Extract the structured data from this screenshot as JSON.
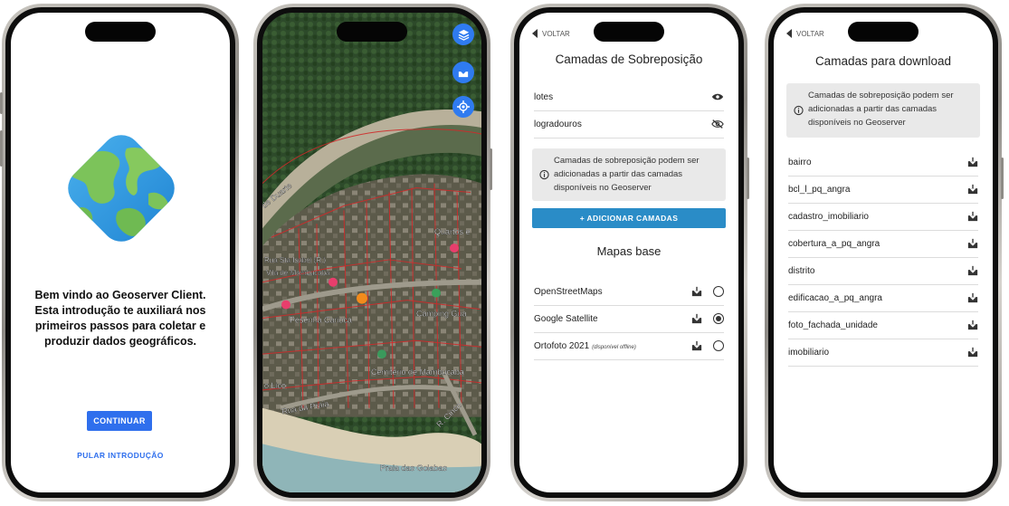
{
  "screen1": {
    "welcome_text": "Bem vindo ao Geoserver Client. Esta introdução te auxiliará nos primeiros passos para coletar e produzir dados geográficos.",
    "continue_label": "CONTINUAR",
    "skip_label": "PULAR INTRODUÇÃO",
    "accent": "#2f6fed"
  },
  "screen2": {
    "buttons": [
      {
        "icon": "layers-icon"
      },
      {
        "icon": "download-icon"
      },
      {
        "icon": "locate-icon"
      }
    ],
    "map_labels": [
      "de Duarte",
      "Quartos e",
      "Rua Sta Isabel (R.)",
      "Vila de Mambucaba",
      "Pesenha Carioca",
      "Camping Gua",
      "o Lico",
      "Cemitério de Mambucaba",
      "Rua da Praia",
      "R. Cinco",
      "Praia das Goiabas"
    ]
  },
  "screen3": {
    "back_label": "VOLTAR",
    "title": "Camadas de Sobreposição",
    "layers": [
      {
        "name": "lotes",
        "visible": true
      },
      {
        "name": "logradouros",
        "visible": false
      }
    ],
    "info_text": "Camadas de sobreposição podem ser adicionadas a partir das camadas disponíveis no Geoserver",
    "add_button": "+ ADICIONAR CAMADAS",
    "base_title": "Mapas base",
    "base_maps": [
      {
        "name": "OpenStreetMaps",
        "note": "",
        "selected": false
      },
      {
        "name": "Google Satellite",
        "note": "",
        "selected": true
      },
      {
        "name": "Ortofoto 2021",
        "note": "(disponível offline)",
        "selected": false
      }
    ],
    "button_color": "#2a8cc7"
  },
  "screen4": {
    "back_label": "VOLTAR",
    "title": "Camadas para download",
    "info_text": "Camadas de sobreposição podem ser adicionadas a partir das camadas disponíveis no Geoserver",
    "layers": [
      "bairro",
      "bcl_l_pq_angra",
      "cadastro_imobiliario",
      "cobertura_a_pq_angra",
      "distrito",
      "edificacao_a_pq_angra",
      "foto_fachada_unidade",
      "imobiliario"
    ]
  }
}
